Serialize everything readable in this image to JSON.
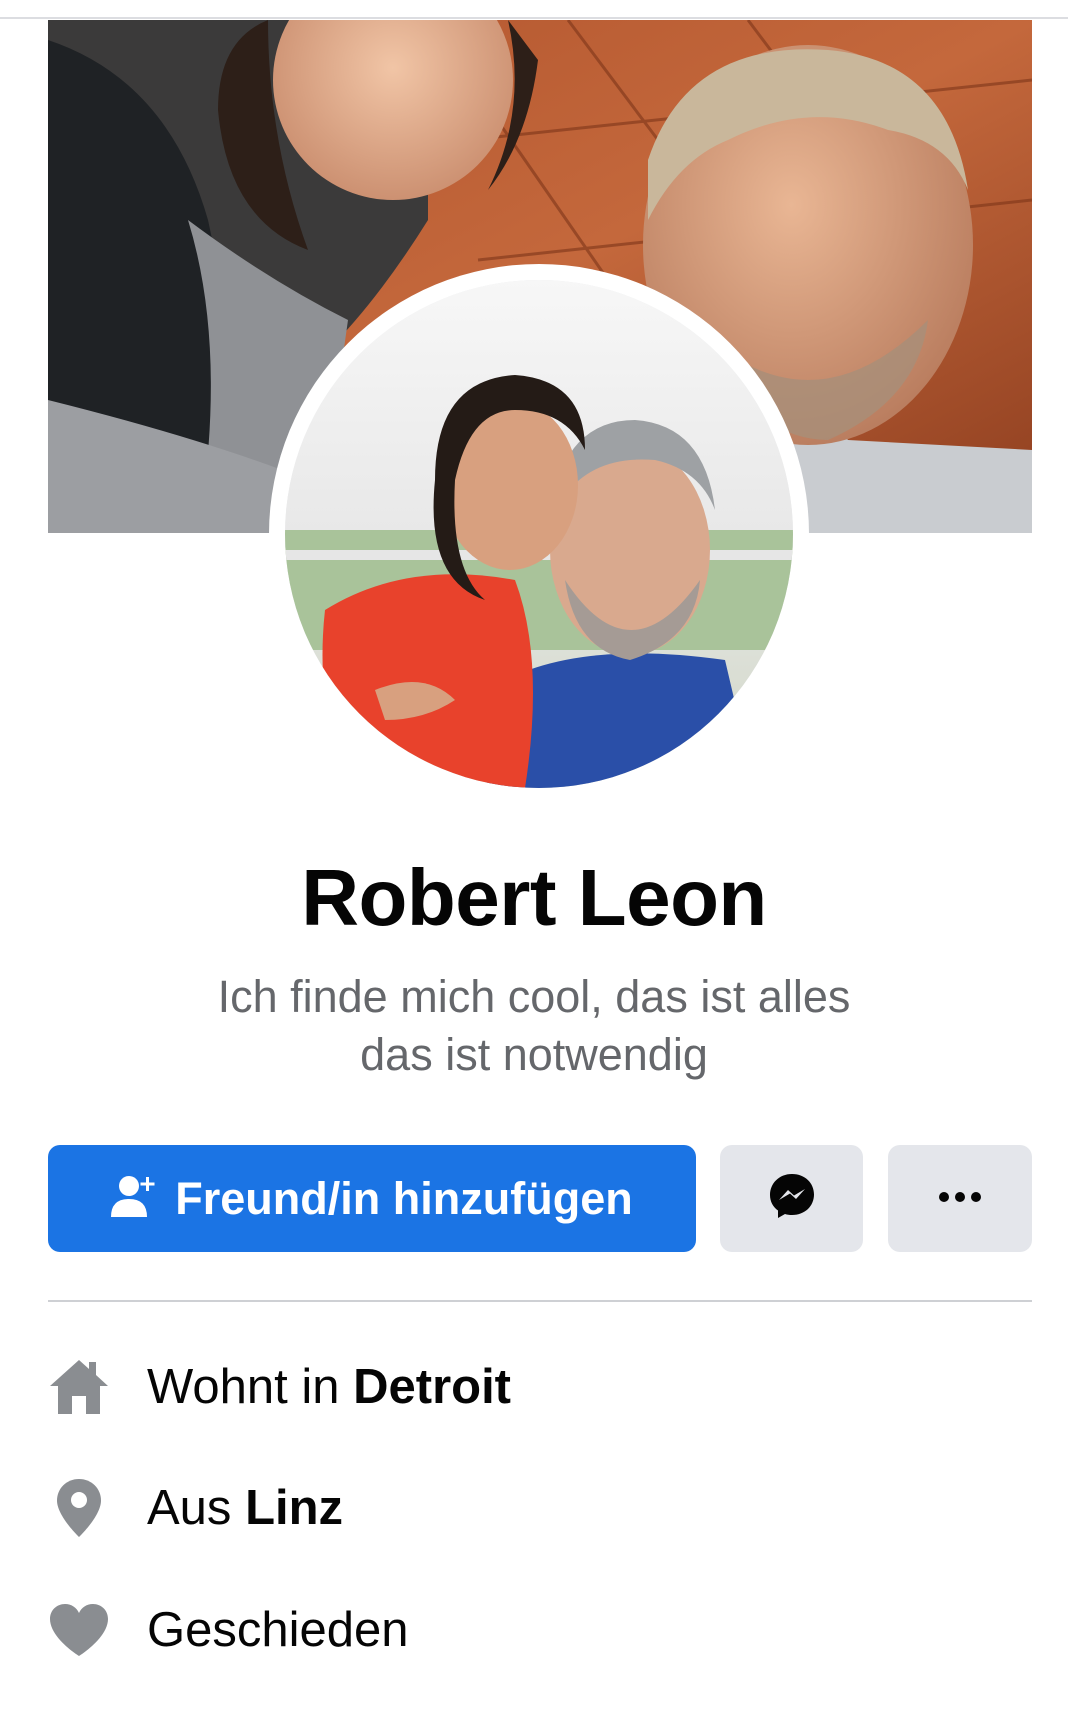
{
  "profile": {
    "name": "Robert Leon",
    "bio_line1": "Ich finde mich cool, das ist alles",
    "bio_line2": "das ist notwendig"
  },
  "actions": {
    "add_friend_label": "Freund/in hinzufügen",
    "messenger_icon": "messenger-icon",
    "more_icon": "more-icon"
  },
  "intro": [
    {
      "icon": "home-icon",
      "prefix": "Wohnt in ",
      "value": "Detroit"
    },
    {
      "icon": "location-pin-icon",
      "prefix": "Aus ",
      "value": "Linz"
    },
    {
      "icon": "heart-icon",
      "prefix": "Geschieden",
      "value": ""
    }
  ],
  "colors": {
    "primary": "#1b74e4",
    "secondary_button": "#e4e6eb",
    "secondary_text": "#65676b",
    "icon_gray": "#8a8d91"
  }
}
